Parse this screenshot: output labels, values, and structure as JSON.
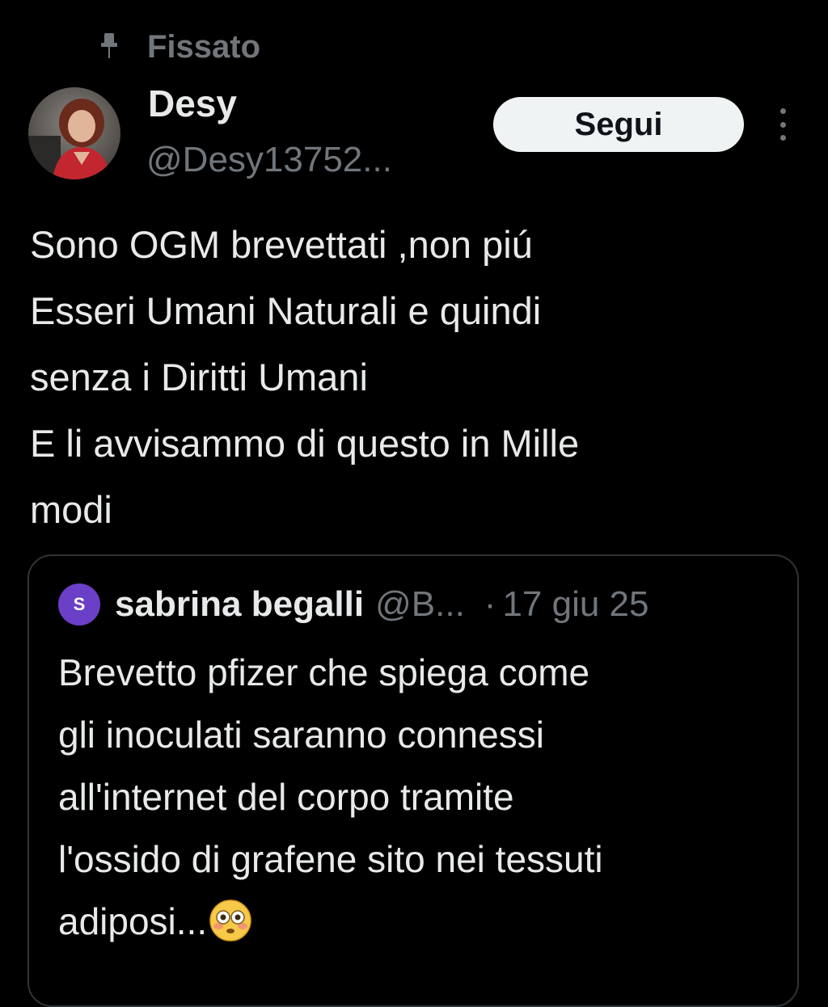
{
  "pinned": {
    "label": "Fissato",
    "icon": "pin-icon"
  },
  "author": {
    "display_name": "Desy",
    "handle": "@Desy13752..."
  },
  "follow_button": {
    "label": "Segui"
  },
  "tweet": {
    "text": "Sono OGM brevettati ,non piú\nEsseri Umani Naturali e quindi\nsenza i Diritti Umani\nE li avvisammo di questo in Mille\nmodi"
  },
  "quote": {
    "avatar_letter": "S",
    "name": "sabrina begalli",
    "handle": "@B...",
    "separator": "·",
    "date": "17 giu 25",
    "text": "Brevetto pfizer che spiega come\ngli inoculati saranno connessi\nall'internet del corpo tramite\nl'ossido di grafene sito nei tessuti\nadiposi...",
    "emoji": "flushed-face-emoji"
  },
  "colors": {
    "background": "#000000",
    "primary_text": "#e7e9ea",
    "secondary_text": "#71767b",
    "button_bg": "#eff3f4",
    "quote_border": "#2f3336",
    "quote_avatar": "#6b3fc7"
  }
}
